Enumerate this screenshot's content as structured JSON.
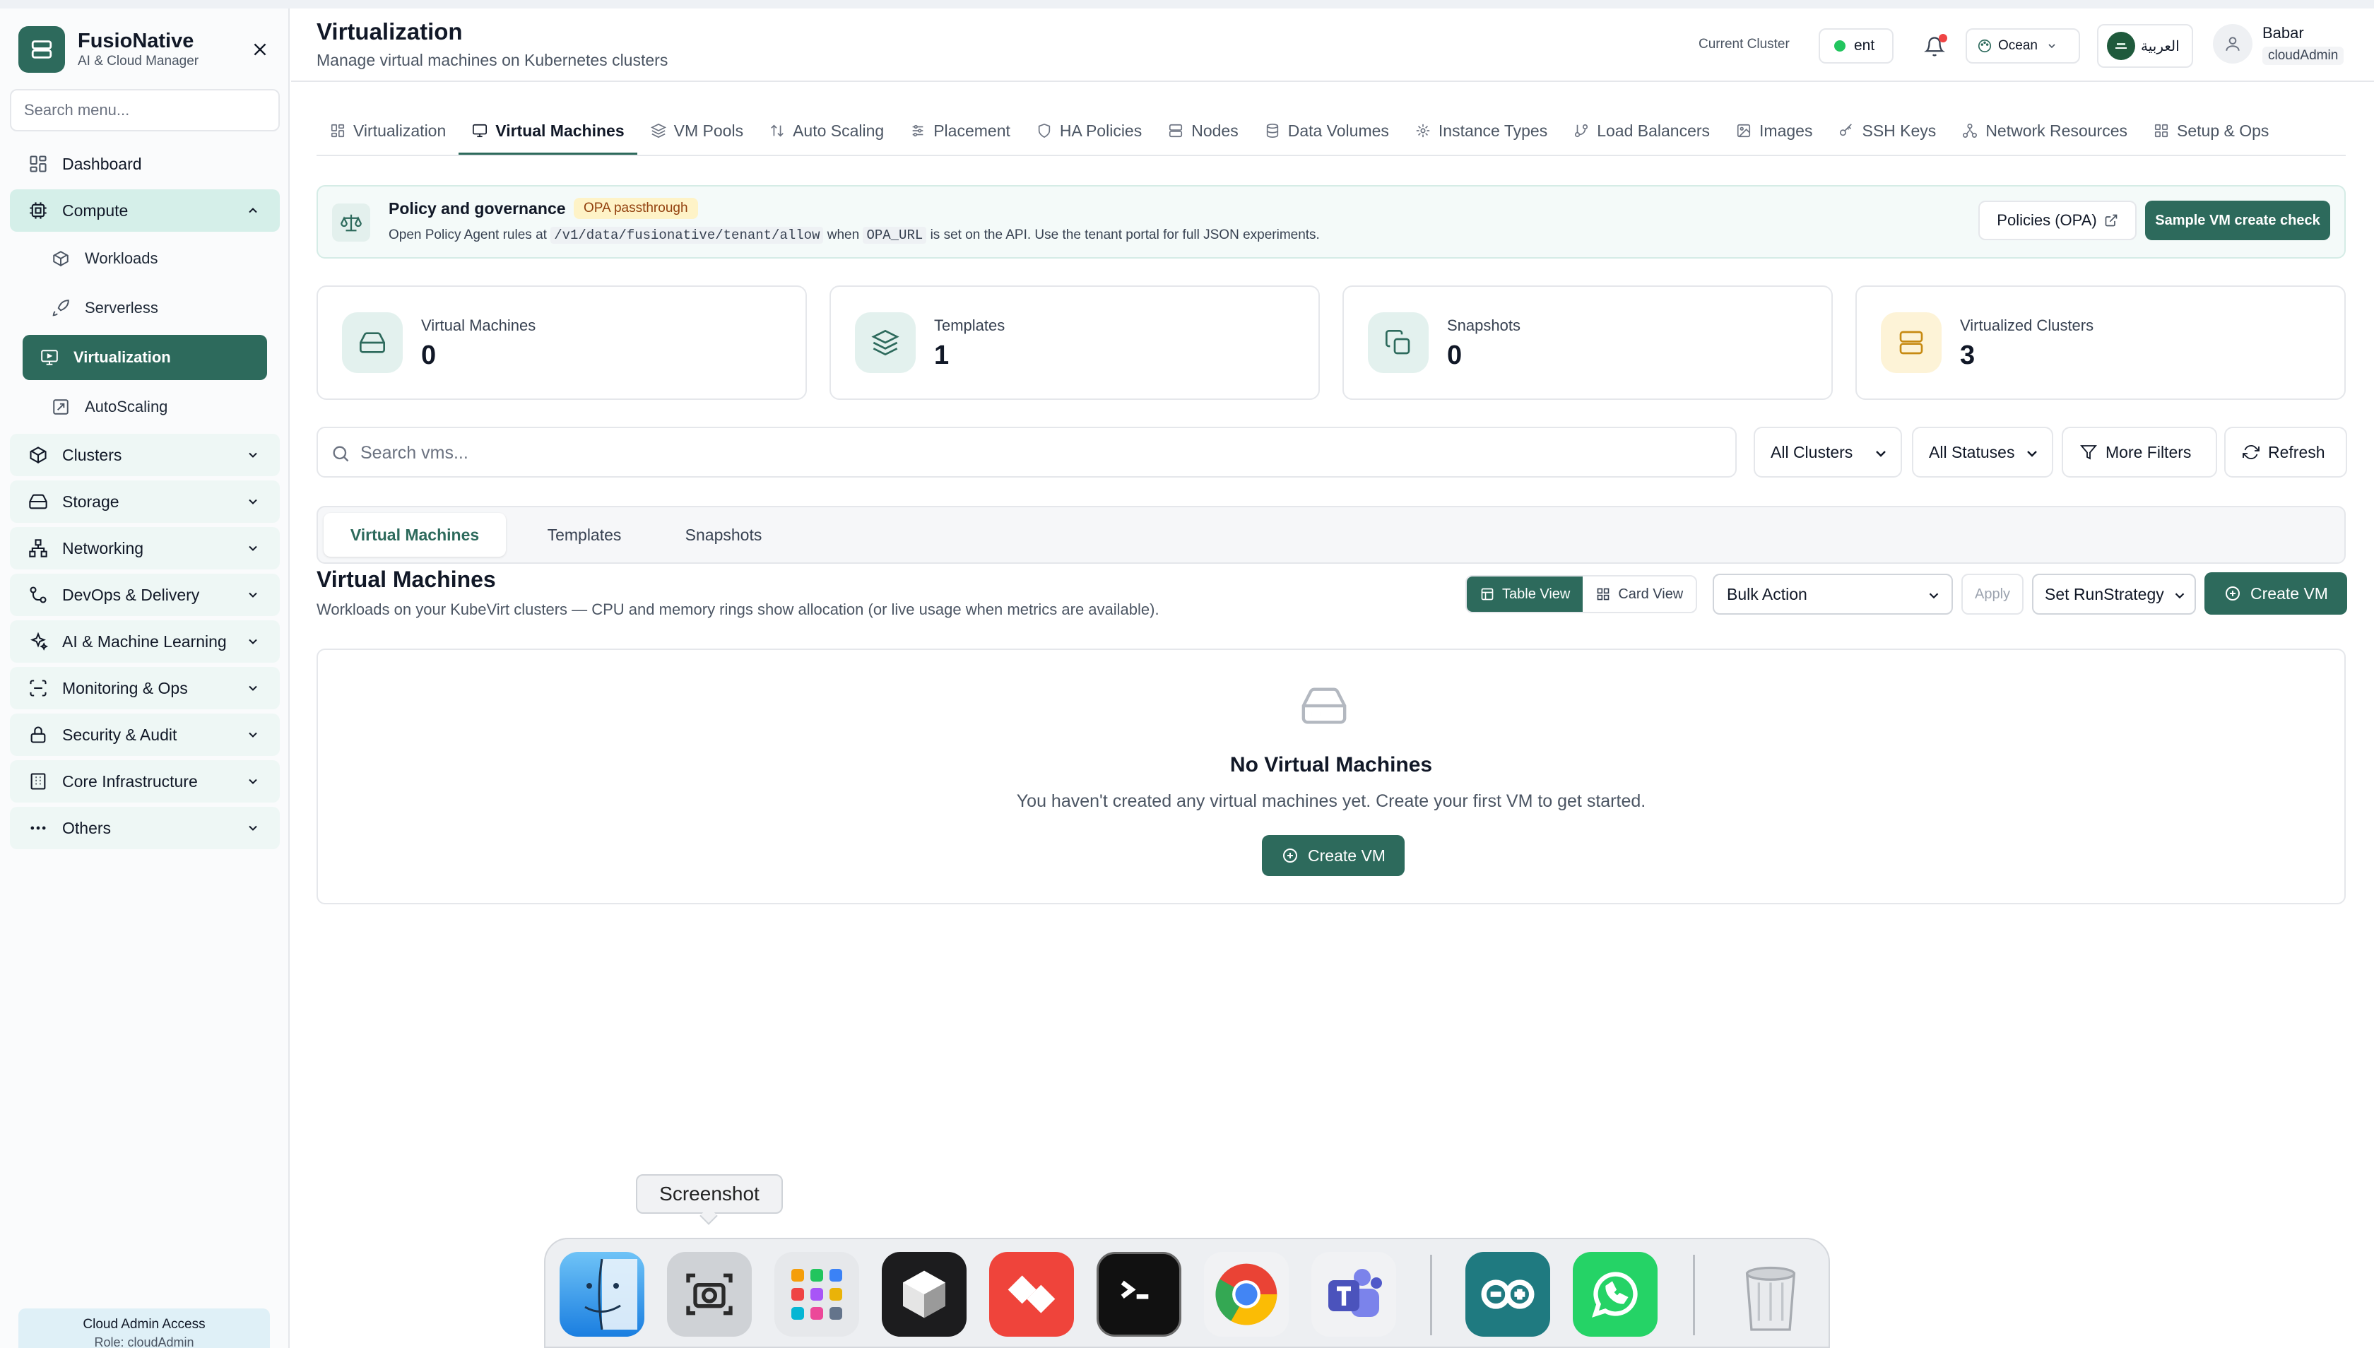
{
  "app": {
    "name": "FusioNative",
    "subtitle": "AI & Cloud Manager"
  },
  "sidebar": {
    "search_placeholder": "Search menu...",
    "items": [
      {
        "label": "Dashboard"
      },
      {
        "label": "Compute",
        "expanded": true,
        "children": [
          {
            "label": "Workloads"
          },
          {
            "label": "Serverless"
          },
          {
            "label": "Virtualization",
            "active": true
          },
          {
            "label": "AutoScaling"
          }
        ]
      },
      {
        "label": "Clusters"
      },
      {
        "label": "Storage"
      },
      {
        "label": "Networking"
      },
      {
        "label": "DevOps & Delivery"
      },
      {
        "label": "AI & Machine Learning"
      },
      {
        "label": "Monitoring & Ops"
      },
      {
        "label": "Security & Audit"
      },
      {
        "label": "Core Infrastructure"
      },
      {
        "label": "Others"
      }
    ],
    "access": {
      "title": "Cloud Admin Access",
      "role": "Role: cloudAdmin"
    }
  },
  "header": {
    "title": "Virtualization",
    "subtitle": "Manage virtual machines on Kubernetes clusters",
    "current_cluster_label": "Current Cluster",
    "cluster": "ent",
    "theme": "Ocean",
    "language": "العربية",
    "user_name": "Babar",
    "user_role": "cloudAdmin"
  },
  "tabs": [
    {
      "label": "Virtualization",
      "icon": "grid-icon"
    },
    {
      "label": "Virtual Machines",
      "icon": "monitor-icon",
      "active": true
    },
    {
      "label": "VM Pools",
      "icon": "layers-icon"
    },
    {
      "label": "Auto Scaling",
      "icon": "arrows-updown-icon"
    },
    {
      "label": "Placement",
      "icon": "sliders-icon"
    },
    {
      "label": "HA Policies",
      "icon": "shield-icon"
    },
    {
      "label": "Nodes",
      "icon": "server-icon"
    },
    {
      "label": "Data Volumes",
      "icon": "database-icon"
    },
    {
      "label": "Instance Types",
      "icon": "cpu-icon"
    },
    {
      "label": "Load Balancers",
      "icon": "git-branch-icon"
    },
    {
      "label": "Images",
      "icon": "image-icon"
    },
    {
      "label": "SSH Keys",
      "icon": "key-icon"
    },
    {
      "label": "Network Resources",
      "icon": "network-icon"
    },
    {
      "label": "Setup & Ops",
      "icon": "grid-icon"
    }
  ],
  "policy": {
    "title": "Policy and governance",
    "badge": "OPA passthrough",
    "desc_prefix": "Open Policy Agent rules at",
    "desc_path": "/v1/data/fusionative/tenant/allow",
    "desc_when": "when",
    "desc_env": "OPA_URL",
    "desc_suffix": "is set on the API. Use the tenant portal for full JSON experiments.",
    "policies_button": "Policies (OPA)",
    "sample_button": "Sample VM create check"
  },
  "stats": [
    {
      "label": "Virtual Machines",
      "value": "0",
      "icon": "hard-drive-icon",
      "color": "#e3f1ee"
    },
    {
      "label": "Templates",
      "value": "1",
      "icon": "layers-icon",
      "color": "#e3f1ee"
    },
    {
      "label": "Snapshots",
      "value": "0",
      "icon": "copy-icon",
      "color": "#e3f1ee"
    },
    {
      "label": "Virtualized Clusters",
      "value": "3",
      "icon": "server-icon",
      "color": "#fdf3d7"
    }
  ],
  "filters": {
    "search_placeholder": "Search vms...",
    "cluster_select": "All Clusters",
    "status_select": "All Statuses",
    "more_filters": "More Filters",
    "refresh": "Refresh"
  },
  "subtabs": [
    {
      "label": "Virtual Machines",
      "active": true
    },
    {
      "label": "Templates"
    },
    {
      "label": "Snapshots"
    }
  ],
  "section": {
    "title": "Virtual Machines",
    "subtitle": "Workloads on your KubeVirt clusters — CPU and memory rings show allocation (or live usage when metrics are available).",
    "table_view": "Table View",
    "card_view": "Card View",
    "bulk_action": "Bulk Action",
    "apply": "Apply",
    "run_strategy": "Set RunStrategy",
    "create_vm": "Create VM"
  },
  "empty": {
    "title": "No Virtual Machines",
    "desc": "You haven't created any virtual machines yet. Create your first VM to get started.",
    "button": "Create VM"
  },
  "dock": {
    "tooltip": "Screenshot",
    "apps": [
      "finder-icon",
      "screenshot-icon",
      "launchpad-icon",
      "parallels-icon",
      "anydesk-icon",
      "terminal-icon",
      "chrome-icon",
      "teams-icon",
      "arduino-icon",
      "whatsapp-icon",
      "trash-icon"
    ]
  },
  "colors": {
    "accent": "#2d6a5c",
    "accent_light": "#d5efe9"
  }
}
